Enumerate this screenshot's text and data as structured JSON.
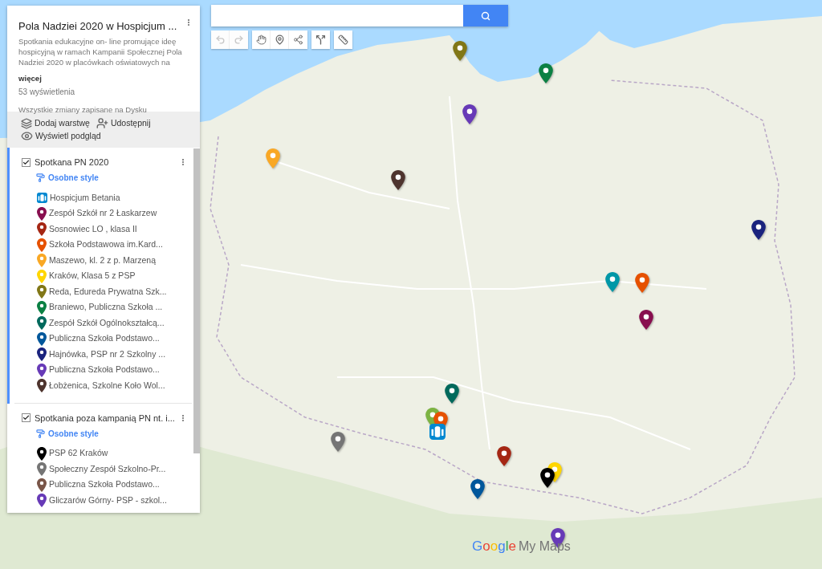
{
  "map_panel": {
    "title": "Pola Nadziei 2020 w Hospicjum ...",
    "description": "Spotkania edukacyjne on- line promujące ideę hospicyjną w ramach Kampanii Społecznej Pola Nadziei 2020 w placówkach oświatowych na",
    "more_link": "więcej",
    "views": "53 wyświetlenia",
    "save_status": "Wszystkie zmiany zapisane na Dysku",
    "actions": [
      {
        "kind": "add_layer",
        "label": "Dodaj warstwę"
      },
      {
        "kind": "share",
        "label": "Udostępnij"
      },
      {
        "kind": "preview",
        "label": "Wyświetl podgląd"
      }
    ],
    "layers": [
      {
        "name": "Spotkana PN 2020",
        "checked": true,
        "selected": true,
        "style_link": "Osobne style",
        "items": [
          {
            "kind": "hospice",
            "color": "#0288d1",
            "label": "Hospicjum Betania"
          },
          {
            "kind": "pin",
            "color": "#880e4f",
            "label": "Zespół Szkół nr 2 Łaskarzew"
          },
          {
            "kind": "pin",
            "color": "#a52714",
            "label": "Sosnowiec LO , klasa II"
          },
          {
            "kind": "pin",
            "color": "#e65100",
            "label": "Szkoła Podstawowa im.Kard..."
          },
          {
            "kind": "pin",
            "color": "#f9a825",
            "label": "Maszewo, kl. 2 z p. Marzeną"
          },
          {
            "kind": "pin",
            "color": "#ffd600",
            "label": "Kraków, Klasa 5 z PSP"
          },
          {
            "kind": "pin",
            "color": "#817717",
            "label": "Reda, Edureda Prywatna Szk..."
          },
          {
            "kind": "pin",
            "color": "#0b8043",
            "label": "Braniewo,  Publiczna Szkoła ..."
          },
          {
            "kind": "pin",
            "color": "#00695c",
            "label": "Zespół Szkół Ogólnokształcą..."
          },
          {
            "kind": "pin",
            "color": "#01579b",
            "label": "Publiczna Szkoła Podstawo..."
          },
          {
            "kind": "pin",
            "color": "#1a237e",
            "label": "Hajnówka, PSP nr 2 Szkolny ..."
          },
          {
            "kind": "pin",
            "color": "#673ab7",
            "label": "Publiczna Szkoła Podstawo..."
          },
          {
            "kind": "pin",
            "color": "#4e342e",
            "label": "Łobżenica, Szkolne Koło Wol..."
          }
        ]
      },
      {
        "name": "Spotkania poza kampanią PN nt. i...",
        "checked": true,
        "selected": false,
        "style_link": "Osobne style",
        "items": [
          {
            "kind": "pin",
            "color": "#000000",
            "label": "PSP 62 Kraków"
          },
          {
            "kind": "pin",
            "color": "#757575",
            "label": "Społeczny Zespół Szkolno-Pr..."
          },
          {
            "kind": "pin",
            "color": "#795548",
            "label": "Publiczna Szkoła Podstawo..."
          },
          {
            "kind": "pin",
            "color": "#673ab7",
            "label": "Gliczarów Górny- PSP - szkol..."
          }
        ]
      }
    ]
  },
  "toolbar": [
    {
      "tools": [
        {
          "kind": "undo",
          "disabled": true
        },
        {
          "kind": "redo",
          "disabled": true
        }
      ]
    },
    {
      "tools": [
        {
          "kind": "pan",
          "disabled": false
        },
        {
          "kind": "marker",
          "disabled": false
        },
        {
          "kind": "line",
          "disabled": false
        }
      ]
    },
    {
      "tools": [
        {
          "kind": "route",
          "disabled": false
        }
      ]
    },
    {
      "tools": [
        {
          "kind": "measure",
          "disabled": false
        }
      ]
    }
  ],
  "map": {
    "markers": [
      {
        "kind": "pin",
        "color": "#817717"
      },
      {
        "kind": "pin",
        "color": "#0b8043"
      },
      {
        "kind": "pin",
        "color": "#673ab7"
      },
      {
        "kind": "pin",
        "color": "#f9a825"
      },
      {
        "kind": "pin",
        "color": "#4e342e"
      },
      {
        "kind": "pin",
        "color": "#1a237e"
      },
      {
        "kind": "pin",
        "color": "#0097a7"
      },
      {
        "kind": "pin",
        "color": "#e65100"
      },
      {
        "kind": "pin",
        "color": "#880e4f"
      },
      {
        "kind": "pin",
        "color": "#00695c"
      },
      {
        "kind": "pin",
        "color": "#7cb342"
      },
      {
        "kind": "pin",
        "color": "#e65100"
      },
      {
        "kind": "hospice",
        "color": "#0288d1"
      },
      {
        "kind": "pin",
        "color": "#757575"
      },
      {
        "kind": "pin",
        "color": "#a52714"
      },
      {
        "kind": "pin",
        "color": "#ffd600"
      },
      {
        "kind": "pin",
        "color": "#000000"
      },
      {
        "kind": "pin",
        "color": "#01579b"
      },
      {
        "kind": "pin",
        "color": "#673ab7"
      }
    ],
    "logo": {
      "brand": "Google",
      "product": "My Maps"
    }
  }
}
